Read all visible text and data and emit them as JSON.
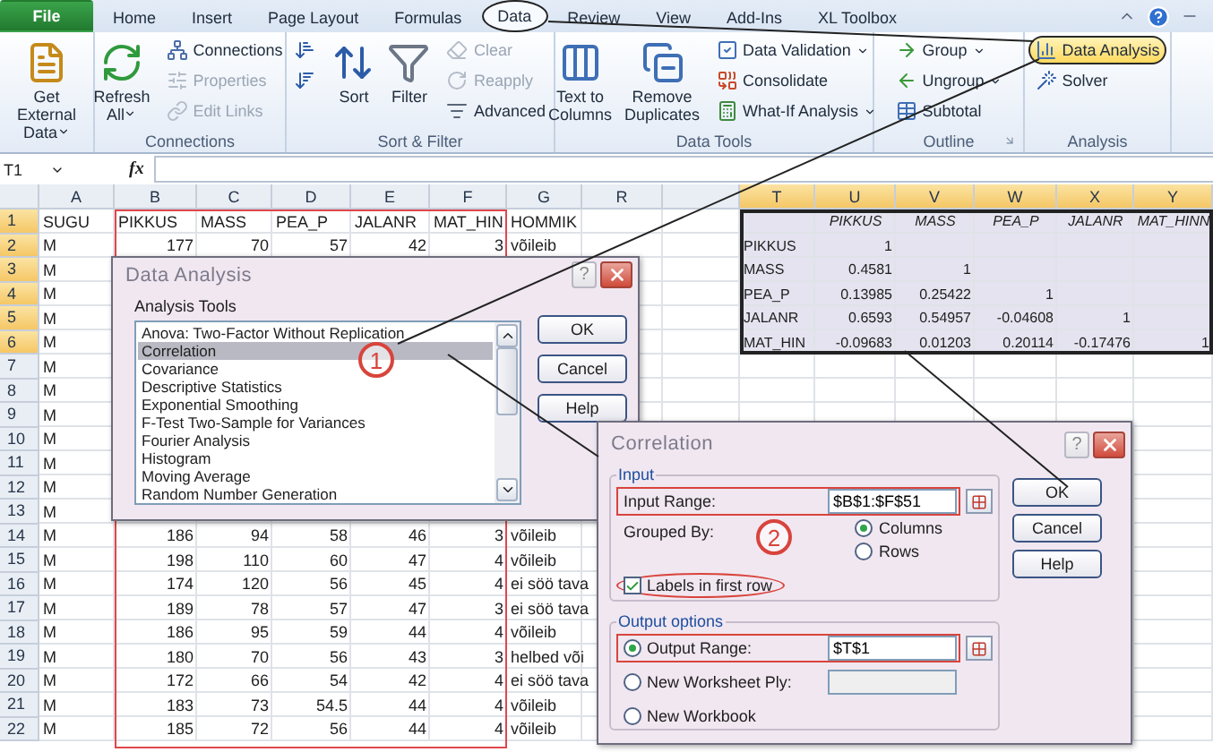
{
  "ribbon_tabs": [
    {
      "label": "File",
      "kind": "file",
      "selected": false
    },
    {
      "label": "Home",
      "kind": "tab",
      "selected": false
    },
    {
      "label": "Insert",
      "kind": "tab",
      "selected": false
    },
    {
      "label": "Page Layout",
      "kind": "tab",
      "selected": false
    },
    {
      "label": "Formulas",
      "kind": "tab",
      "selected": false
    },
    {
      "label": "Data",
      "kind": "tab",
      "selected": true
    },
    {
      "label": "Review",
      "kind": "tab",
      "selected": false
    },
    {
      "label": "View",
      "kind": "tab",
      "selected": false
    },
    {
      "label": "Add-Ins",
      "kind": "tab",
      "selected": false
    },
    {
      "label": "XL Toolbox",
      "kind": "tab",
      "selected": false
    }
  ],
  "ribbon_groups": [
    {
      "columns": [
        {
          "kind": "large",
          "lines": [
            "Get External",
            "Data"
          ],
          "dropdown": true,
          "disabled": false
        }
      ]
    },
    {
      "label": "Connections",
      "columns": [
        {
          "kind": "large",
          "lines": [
            "Refresh",
            "All"
          ],
          "dropdown": true,
          "disabled": false
        },
        {
          "kind": "stack",
          "items": [
            {
              "label": "Connections",
              "disabled": false,
              "dropdown": false,
              "highlighted": false
            },
            {
              "label": "Properties",
              "disabled": true,
              "dropdown": false,
              "highlighted": false
            },
            {
              "label": "Edit Links",
              "disabled": true,
              "dropdown": false,
              "highlighted": false
            }
          ]
        }
      ]
    },
    {
      "label": "Sort & Filter",
      "columns": [
        {
          "kind": "stack",
          "items": [
            {
              "disabled": false,
              "dropdown": false,
              "highlighted": false
            },
            {
              "disabled": false,
              "dropdown": false,
              "highlighted": false
            }
          ]
        },
        {
          "kind": "large",
          "lines": [
            "Sort"
          ],
          "dropdown": false,
          "disabled": false
        },
        {
          "kind": "large",
          "lines": [
            "Filter"
          ],
          "dropdown": false,
          "disabled": false
        },
        {
          "kind": "stack",
          "items": [
            {
              "label": "Clear",
              "disabled": true,
              "dropdown": false,
              "highlighted": false
            },
            {
              "label": "Reapply",
              "disabled": true,
              "dropdown": false,
              "highlighted": false
            },
            {
              "label": "Advanced",
              "disabled": false,
              "dropdown": false,
              "highlighted": false
            }
          ]
        }
      ]
    },
    {
      "label": "Data Tools",
      "columns": [
        {
          "kind": "large",
          "lines": [
            "Text to",
            "Columns"
          ],
          "dropdown": false,
          "disabled": false
        },
        {
          "kind": "large",
          "lines": [
            "Remove",
            "Duplicates"
          ],
          "dropdown": false,
          "disabled": false
        },
        {
          "kind": "stack",
          "items": [
            {
              "label": "Data Validation",
              "disabled": false,
              "dropdown": true,
              "highlighted": false
            },
            {
              "label": "Consolidate",
              "disabled": false,
              "dropdown": false,
              "highlighted": false
            },
            {
              "label": "What-If Analysis",
              "disabled": false,
              "dropdown": true,
              "highlighted": false
            }
          ]
        }
      ]
    },
    {
      "label": "Outline",
      "launcher": true,
      "columns": [
        {
          "kind": "stack",
          "items": [
            {
              "label": "Group",
              "disabled": false,
              "dropdown": true,
              "highlighted": false
            },
            {
              "label": "Ungroup",
              "disabled": false,
              "dropdown": true,
              "highlighted": false
            },
            {
              "label": "Subtotal",
              "disabled": false,
              "dropdown": false,
              "highlighted": false
            }
          ]
        }
      ]
    },
    {
      "label": "Analysis",
      "columns": [
        {
          "kind": "stack",
          "items": [
            {
              "label": "Data Analysis",
              "disabled": false,
              "dropdown": false,
              "highlighted": true
            },
            {
              "label": "Solver",
              "disabled": false,
              "dropdown": false,
              "highlighted": false
            }
          ]
        }
      ]
    }
  ],
  "formula_bar": {
    "name_box": "T1",
    "function_label": "fx"
  },
  "sheet": {
    "columns": [
      {
        "label": "A",
        "selected": false,
        "framed": false
      },
      {
        "label": "B",
        "selected": false,
        "framed": true
      },
      {
        "label": "C",
        "selected": false,
        "framed": true
      },
      {
        "label": "D",
        "selected": false,
        "framed": true
      },
      {
        "label": "E",
        "selected": false,
        "framed": true
      },
      {
        "label": "F",
        "selected": false,
        "framed": true
      },
      {
        "label": "G",
        "selected": false,
        "framed": false
      },
      {
        "label": "R",
        "selected": false,
        "framed": false
      },
      {
        "label": "T",
        "selected": true,
        "framed": false
      },
      {
        "label": "U",
        "selected": true,
        "framed": false
      },
      {
        "label": "V",
        "selected": true,
        "framed": false
      },
      {
        "label": "W",
        "selected": true,
        "framed": false
      },
      {
        "label": "X",
        "selected": true,
        "framed": false
      },
      {
        "label": "Y",
        "selected": true,
        "framed": false
      }
    ],
    "rows": [
      {
        "number": "1",
        "selected": true,
        "cells": [
          "SUGU",
          "PIKKUS",
          "MASS",
          "PEA_P",
          "JALANR",
          "MAT_HIN",
          "HOMMIK"
        ]
      },
      {
        "number": "2",
        "selected": true,
        "cells": [
          "M",
          "177",
          "70",
          "57",
          "42",
          "3",
          "võileib"
        ]
      },
      {
        "number": "3",
        "selected": true,
        "cells": [
          "M"
        ]
      },
      {
        "number": "4",
        "selected": true,
        "cells": [
          "M"
        ]
      },
      {
        "number": "5",
        "selected": true,
        "cells": [
          "M"
        ]
      },
      {
        "number": "6",
        "selected": true,
        "cells": [
          "M"
        ]
      },
      {
        "number": "7",
        "selected": false,
        "cells": [
          "M"
        ]
      },
      {
        "number": "8",
        "selected": false,
        "cells": [
          "M"
        ]
      },
      {
        "number": "9",
        "selected": false,
        "cells": [
          "M"
        ]
      },
      {
        "number": "10",
        "selected": false,
        "cells": [
          "M"
        ]
      },
      {
        "number": "11",
        "selected": false,
        "cells": [
          "M"
        ]
      },
      {
        "number": "12",
        "selected": false,
        "cells": [
          "M"
        ]
      },
      {
        "number": "13",
        "selected": false,
        "cells": [
          "M"
        ]
      },
      {
        "number": "14",
        "selected": false,
        "cells": [
          "M",
          "186",
          "94",
          "58",
          "46",
          "3",
          "võileib"
        ]
      },
      {
        "number": "15",
        "selected": false,
        "cells": [
          "M",
          "198",
          "110",
          "60",
          "47",
          "4",
          "võileib"
        ]
      },
      {
        "number": "16",
        "selected": false,
        "cells": [
          "M",
          "174",
          "120",
          "56",
          "45",
          "4",
          "ei söö tava"
        ]
      },
      {
        "number": "17",
        "selected": false,
        "cells": [
          "M",
          "189",
          "78",
          "57",
          "47",
          "3",
          "ei söö tava"
        ]
      },
      {
        "number": "18",
        "selected": false,
        "cells": [
          "M",
          "186",
          "95",
          "59",
          "44",
          "4",
          "võileib"
        ]
      },
      {
        "number": "19",
        "selected": false,
        "cells": [
          "M",
          "180",
          "70",
          "56",
          "43",
          "3",
          "helbed või"
        ]
      },
      {
        "number": "20",
        "selected": false,
        "cells": [
          "M",
          "172",
          "66",
          "54",
          "42",
          "4",
          "ei söö tava"
        ]
      },
      {
        "number": "21",
        "selected": false,
        "cells": [
          "M",
          "183",
          "73",
          "54.5",
          "44",
          "4",
          "võileib"
        ]
      },
      {
        "number": "22",
        "selected": false,
        "cells": [
          "M",
          "185",
          "72",
          "56",
          "44",
          "4",
          "võileib"
        ]
      }
    ],
    "results": {
      "headers": [
        "PIKKUS",
        "MASS",
        "PEA_P",
        "JALANR",
        "MAT_HINN"
      ],
      "rows": [
        {
          "label": "PIKKUS",
          "values": [
            "1"
          ]
        },
        {
          "label": "MASS",
          "values": [
            "0.4581",
            "1"
          ]
        },
        {
          "label": "PEA_P",
          "values": [
            "0.13985",
            "0.25422",
            "1"
          ]
        },
        {
          "label": "JALANR",
          "values": [
            "0.6593",
            "0.54957",
            "-0.04608",
            "1"
          ]
        },
        {
          "label": "MAT_HIN",
          "values": [
            "-0.09683",
            "0.01203",
            "0.20114",
            "-0.17476",
            "1"
          ]
        }
      ]
    }
  },
  "data_analysis_dialog": {
    "title": "Data Analysis",
    "help_glyph": "?",
    "tools_label": "Analysis Tools",
    "marker": "1",
    "tools": [
      {
        "label": "Anova: Two-Factor Without Replication",
        "selected": false
      },
      {
        "label": "Correlation",
        "selected": true
      },
      {
        "label": "Covariance",
        "selected": false
      },
      {
        "label": "Descriptive Statistics",
        "selected": false
      },
      {
        "label": "Exponential Smoothing",
        "selected": false
      },
      {
        "label": "F-Test Two-Sample for Variances",
        "selected": false
      },
      {
        "label": "Fourier Analysis",
        "selected": false
      },
      {
        "label": "Histogram",
        "selected": false
      },
      {
        "label": "Moving Average",
        "selected": false
      },
      {
        "label": "Random Number Generation",
        "selected": false
      }
    ],
    "buttons": [
      "OK",
      "Cancel",
      "Help"
    ]
  },
  "correlation_dialog": {
    "title": "Correlation",
    "help_glyph": "?",
    "marker": "2",
    "input_group": {
      "legend": "Input",
      "range_label": "Input Range:",
      "range_value": "$B$1:$F$51",
      "range_framed": true,
      "grouped_by_label": "Grouped By:",
      "grouping": [
        {
          "label": "Columns",
          "selected": true
        },
        {
          "label": "Rows",
          "selected": false
        }
      ],
      "labels_checkbox": {
        "label": "Labels in first row",
        "checked": true,
        "circled": true
      }
    },
    "output_group": {
      "legend": "Output options",
      "options": [
        {
          "label": "Output Range:",
          "selected": true,
          "kind": "range",
          "value": "$T$1",
          "framed": true
        },
        {
          "label": "New Worksheet Ply:",
          "selected": false,
          "kind": "name",
          "framed": false
        },
        {
          "label": "New Workbook",
          "selected": false,
          "kind": "none",
          "framed": false
        }
      ]
    },
    "buttons": [
      "OK",
      "Cancel",
      "Help"
    ]
  }
}
